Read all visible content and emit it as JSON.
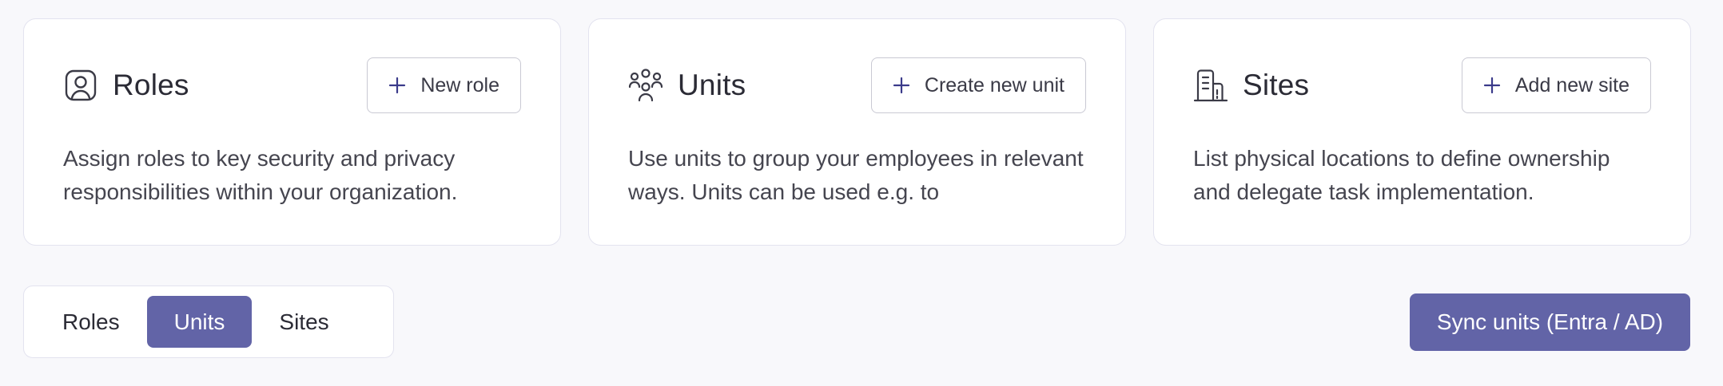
{
  "cards": [
    {
      "title": "Roles",
      "icon": "user-badge-icon",
      "button_label": "New role",
      "description": "Assign roles to key security and privacy responsibilities within your organization."
    },
    {
      "title": "Units",
      "icon": "people-group-icon",
      "button_label": "Create new unit",
      "description": "Use units to group your employees in relevant ways. Units can be used e.g. to"
    },
    {
      "title": "Sites",
      "icon": "building-icon",
      "button_label": "Add new site",
      "description": "List physical locations to define ownership and delegate task implementation."
    }
  ],
  "tabs": [
    {
      "label": "Roles",
      "active": false
    },
    {
      "label": "Units",
      "active": true
    },
    {
      "label": "Sites",
      "active": false
    }
  ],
  "sync_button_label": "Sync units (Entra / AD)",
  "colors": {
    "accent": "#6264a7",
    "card_border": "#e3e3ef",
    "background": "#f8f8fb"
  }
}
